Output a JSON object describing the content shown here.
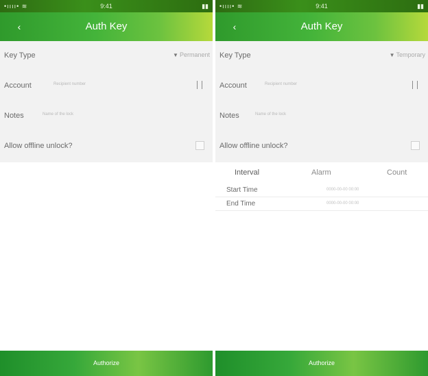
{
  "left": {
    "status": {
      "carrier": "•ıııı• ≋",
      "time": "9:41",
      "battery": "▮▮"
    },
    "title": "Auth Key",
    "form": {
      "key_type_label": "Key Type",
      "key_type_value": "Permanent",
      "account_label": "Account",
      "account_placeholder": "Recipient number",
      "notes_label": "Notes",
      "notes_placeholder": "Name of the lock",
      "offline_label": "Allow offline unlock?"
    },
    "footer": "Authorize"
  },
  "right": {
    "status": {
      "carrier": "•ıııı• ≋",
      "time": "9:41",
      "battery": "▮▮"
    },
    "title": "Auth Key",
    "form": {
      "key_type_label": "Key Type",
      "key_type_value": "Temporary",
      "account_label": "Account",
      "account_placeholder": "Recipient number",
      "notes_label": "Notes",
      "notes_placeholder": "Name of the lock",
      "offline_label": "Allow offline unlock?"
    },
    "tabs": [
      "Interval",
      "Alarm",
      "Count"
    ],
    "times": {
      "start_label": "Start Time",
      "start_value": "0000-00-00 00:00",
      "end_label": "End Time",
      "end_value": "0000-00-00 00:00"
    },
    "footer": "Authorize"
  }
}
